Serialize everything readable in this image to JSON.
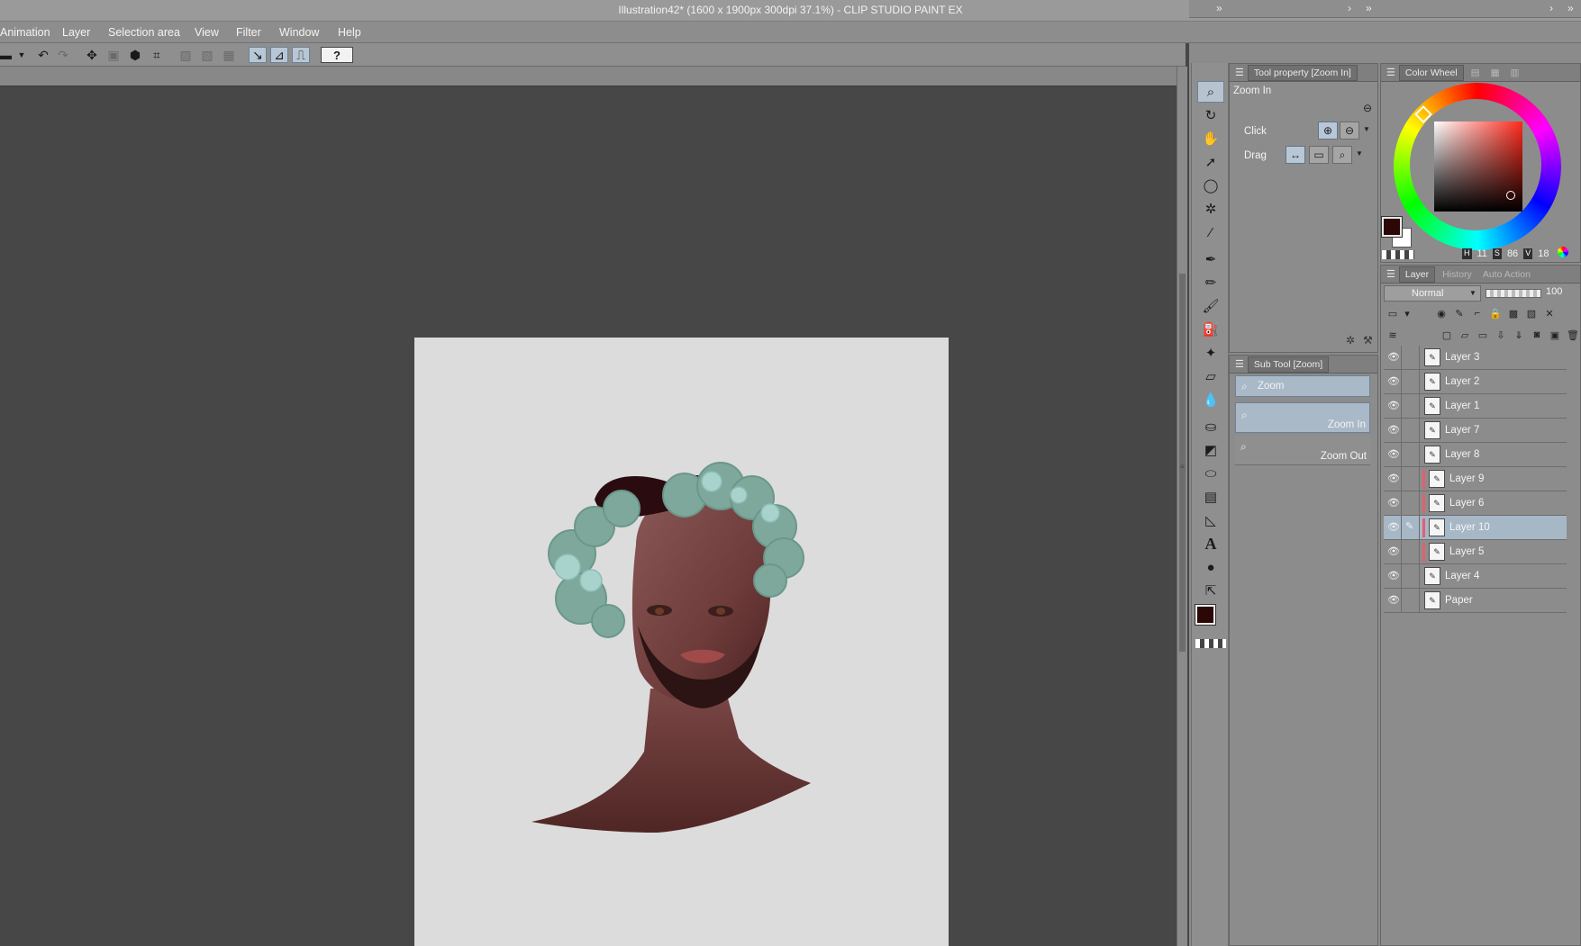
{
  "window": {
    "title": "Illustration42* (1600 x 1900px 300dpi 37.1%)  - CLIP STUDIO PAINT EX",
    "minimize": "▬",
    "restore": "❐",
    "close": "✕"
  },
  "menu": {
    "items": [
      "Animation",
      "Layer",
      "Selection area",
      "View",
      "Filter",
      "Window",
      "Help"
    ]
  },
  "command_bar": {
    "icons": [
      "new-icon",
      "undo-icon",
      "redo-icon",
      "transform-icon",
      "fit-icon",
      "fill-icon",
      "crop-icon",
      "clear-icon",
      "clear-outside-icon",
      "select-all-icon",
      "ruler-snap-icon",
      "special-ruler-snap-icon",
      "grid-snap-icon",
      "help-icon"
    ],
    "help_label": "?"
  },
  "tool_property": {
    "tab_label": "Tool property [Zoom In]",
    "title": "Zoom In",
    "click_label": "Click",
    "drag_label": "Drag"
  },
  "sub_tool": {
    "tab_label": "Sub Tool [Zoom]",
    "group_label": "Zoom",
    "items": [
      {
        "label": "Zoom In",
        "selected": true
      },
      {
        "label": "Zoom Out",
        "selected": false
      }
    ]
  },
  "color_wheel": {
    "tab_label": "Color Wheel",
    "main_color": "#2b0705",
    "sub_color": "#ffffff",
    "h_label": "H",
    "h_value": "11",
    "s_label": "S",
    "s_value": "86",
    "v_label": "V",
    "v_value": "18"
  },
  "layer_panel": {
    "tabs": [
      "Layer",
      "History",
      "Auto Action"
    ],
    "blend_mode": "Normal",
    "opacity": "100",
    "layers": [
      {
        "name": "Layer 3",
        "clipped": false,
        "selected": false,
        "editing": false
      },
      {
        "name": "Layer 2",
        "clipped": false,
        "selected": false,
        "editing": false
      },
      {
        "name": "Layer 1",
        "clipped": false,
        "selected": false,
        "editing": false
      },
      {
        "name": "Layer 7",
        "clipped": false,
        "selected": false,
        "editing": false
      },
      {
        "name": "Layer 8",
        "clipped": false,
        "selected": false,
        "editing": false
      },
      {
        "name": "Layer 9",
        "clipped": true,
        "selected": false,
        "editing": false
      },
      {
        "name": "Layer 6",
        "clipped": true,
        "selected": false,
        "editing": false
      },
      {
        "name": "Layer 10",
        "clipped": true,
        "selected": true,
        "editing": true
      },
      {
        "name": "Layer 5",
        "clipped": true,
        "selected": false,
        "editing": false
      },
      {
        "name": "Layer 4",
        "clipped": false,
        "selected": false,
        "editing": false
      },
      {
        "name": "Paper",
        "clipped": false,
        "selected": false,
        "editing": false
      }
    ]
  },
  "toolbox": {
    "tools": [
      "zoom-icon",
      "rotate-icon",
      "hand-icon",
      "move-icon",
      "lasso-icon",
      "auto-select-icon",
      "eyedropper-icon",
      "pen-icon",
      "pencil-icon",
      "brush-icon",
      "airbrush-icon",
      "decoration-icon",
      "eraser-icon",
      "blend-icon",
      "fill-icon",
      "gradient-icon",
      "figure-icon",
      "frame-icon",
      "ruler-icon",
      "text-icon",
      "balloon-icon",
      "correct-line-icon"
    ]
  },
  "canvas": {
    "paper_color": "#dcdcdc",
    "background_color": "#474747"
  }
}
